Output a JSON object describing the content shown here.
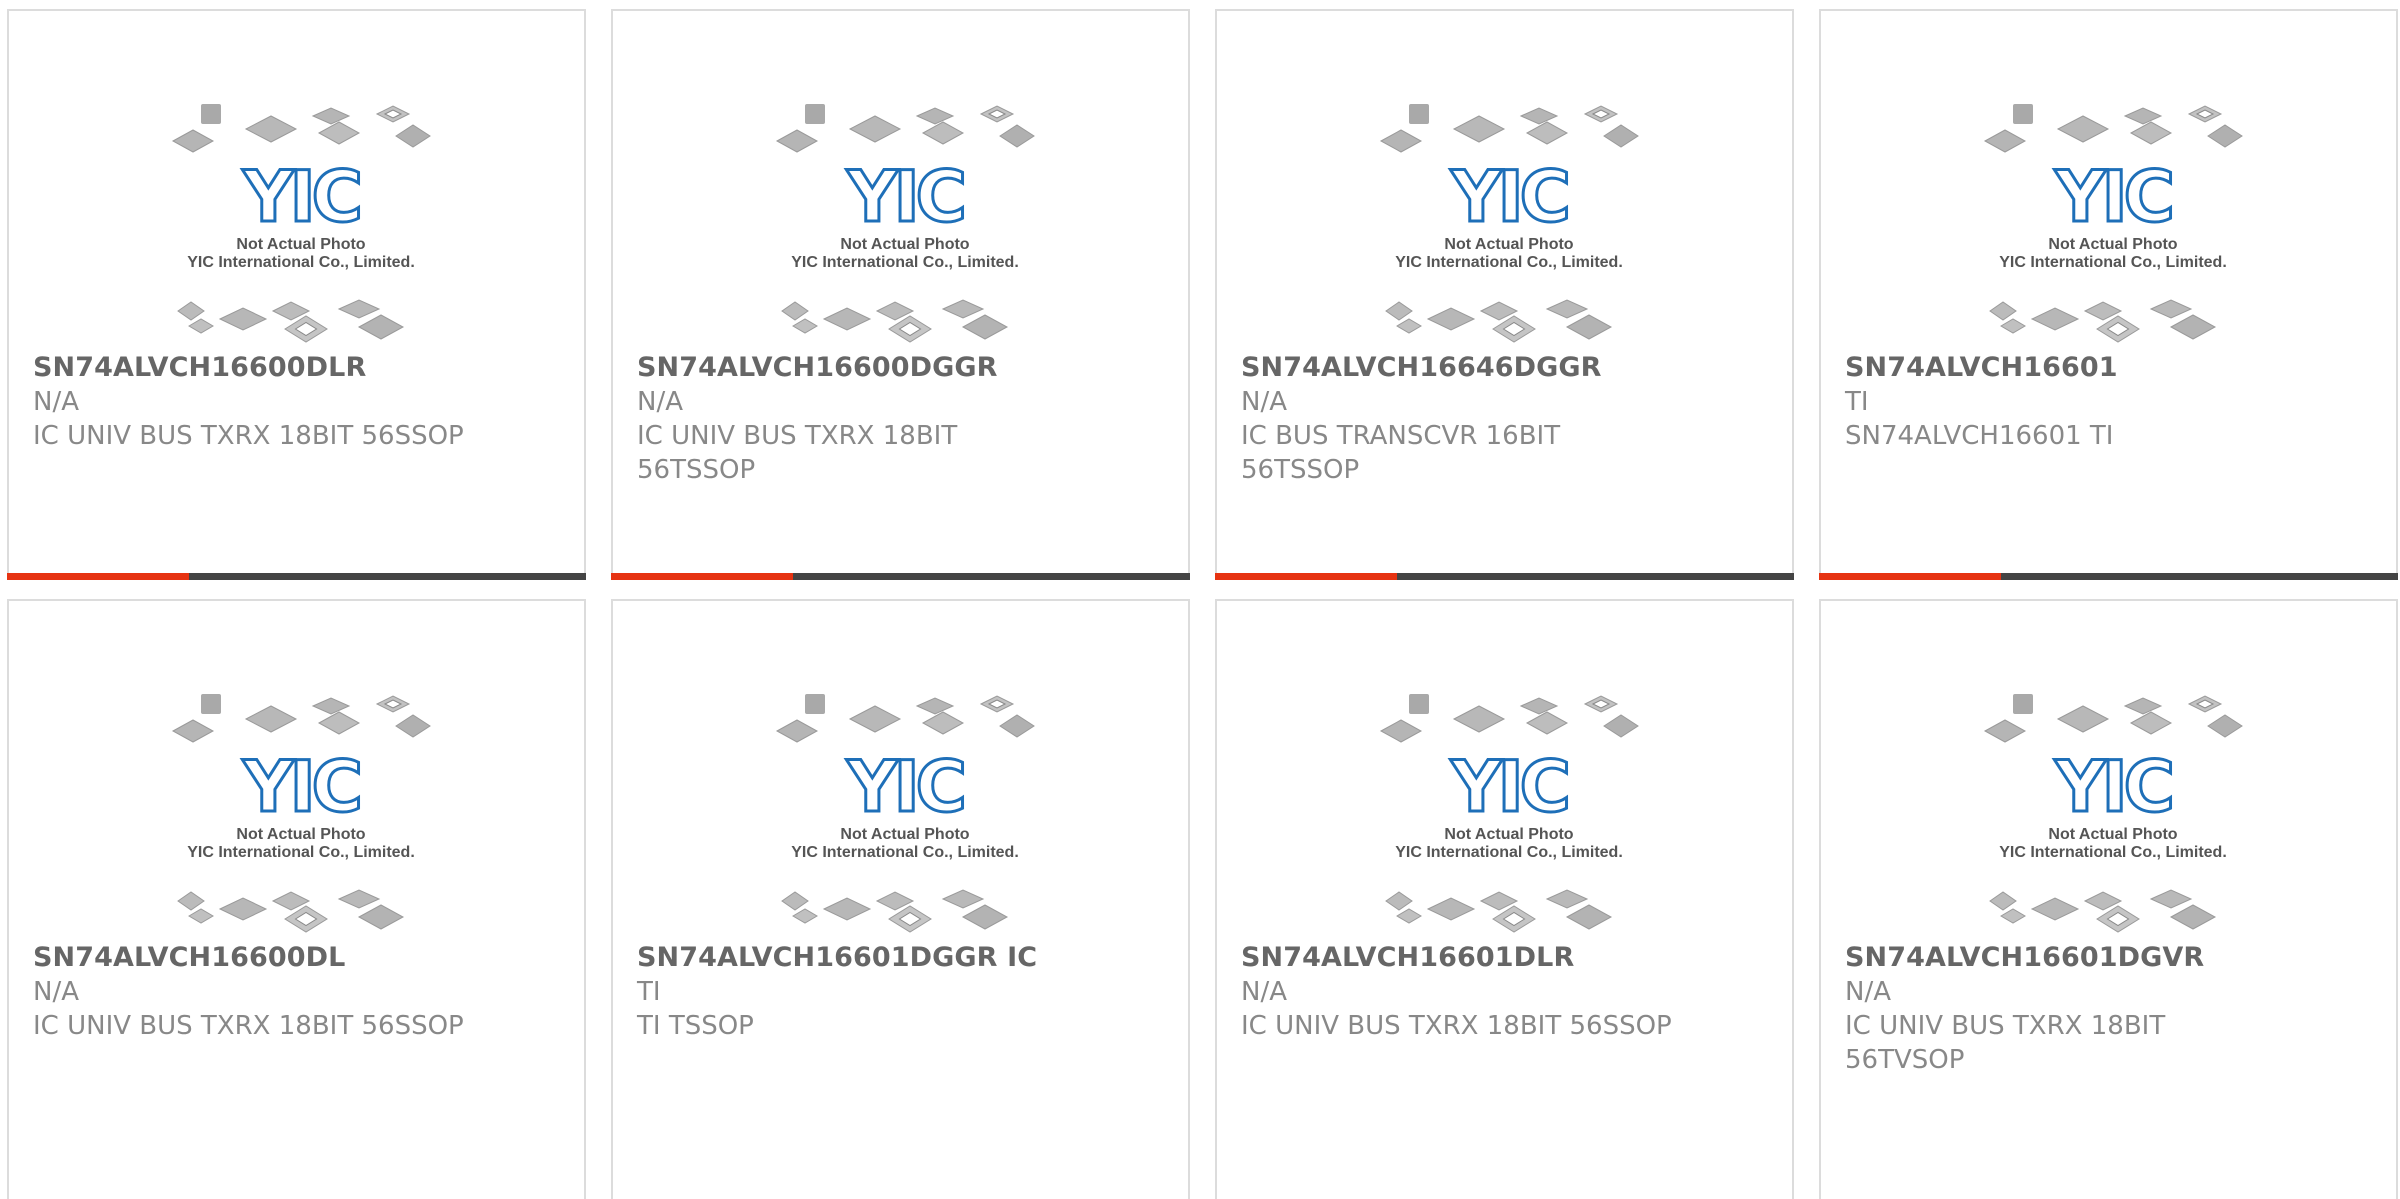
{
  "colors": {
    "accent": "#e63312",
    "bar": "#444444",
    "logo": "#1e6fb8",
    "title": "#666666",
    "text": "#888888"
  },
  "placeholder": {
    "line1": "Not Actual Photo",
    "line2": "YIC International Co., Limited.",
    "logo": "YIC"
  },
  "cards": [
    {
      "name": "SN74ALVCH16600DLR",
      "manufacturer": "N/A",
      "description": "IC UNIV BUS TXRX 18BIT 56SSOP"
    },
    {
      "name": "SN74ALVCH16600DGGR",
      "manufacturer": "N/A",
      "description_lines": [
        "IC UNIV BUS TXRX 18BIT",
        "56TSSOP"
      ]
    },
    {
      "name": "SN74ALVCH16646DGGR",
      "manufacturer": "N/A",
      "description_lines": [
        "IC BUS TRANSCVR 16BIT",
        "56TSSOP"
      ]
    },
    {
      "name": "SN74ALVCH16601",
      "manufacturer": "TI",
      "description": "SN74ALVCH16601 TI"
    },
    {
      "name": "SN74ALVCH16600DL",
      "manufacturer": "N/A",
      "description": "IC UNIV BUS TXRX 18BIT 56SSOP"
    },
    {
      "name": "SN74ALVCH16601DGGR IC",
      "manufacturer": "TI",
      "description": "TI TSSOP"
    },
    {
      "name": "SN74ALVCH16601DLR",
      "manufacturer": "N/A",
      "description": "IC UNIV BUS TXRX 18BIT 56SSOP"
    },
    {
      "name": "SN74ALVCH16601DGVR",
      "manufacturer": "N/A",
      "description_lines": [
        "IC UNIV BUS TXRX 18BIT",
        "56TVSOP"
      ]
    }
  ]
}
